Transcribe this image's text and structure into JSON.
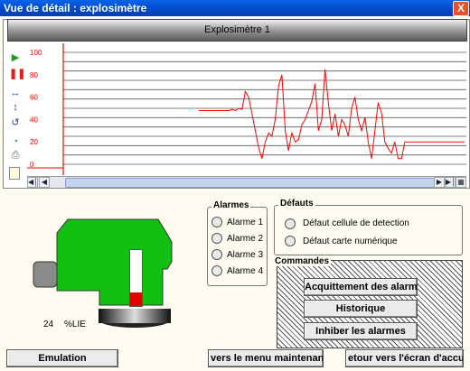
{
  "window": {
    "title": "Vue de détail : explosimètre",
    "close_label": "X"
  },
  "chart": {
    "title": "Explosimètre 1"
  },
  "chart_data": {
    "type": "line",
    "title": "Explosimètre 1",
    "ylim": [
      0,
      100
    ],
    "yticks": [
      0,
      20,
      40,
      60,
      80,
      100
    ],
    "color": "#FF0000",
    "series": [
      {
        "values": [
          48,
          48,
          48,
          48,
          48,
          48,
          48,
          48,
          48,
          48,
          49,
          48,
          50,
          49,
          65,
          60,
          45,
          30,
          15,
          5,
          20,
          28,
          25,
          40,
          70,
          80,
          30,
          12,
          28,
          20,
          22,
          35,
          40,
          48,
          56,
          72,
          30,
          40,
          85,
          55,
          30,
          45,
          25,
          40,
          35,
          25,
          50,
          60,
          40,
          30,
          42,
          20,
          5,
          30,
          55,
          46,
          20,
          14,
          10,
          20,
          5,
          5,
          20,
          20,
          20,
          20,
          20,
          20,
          20,
          20,
          20,
          20,
          20,
          20,
          20,
          20,
          20,
          20,
          20,
          20,
          20
        ]
      }
    ]
  },
  "toolbar_icons": [
    "play-icon",
    "pause-icon",
    "fit-horizontal-icon",
    "fit-vertical-icon",
    "reset-zoom-icon",
    "refresh-icon",
    "print-icon",
    "notes-icon"
  ],
  "alarmes": {
    "legend": "Alarmes",
    "items": [
      "Alarme 1",
      "Alarme 2",
      "Alarme 3",
      "Alarme 4"
    ]
  },
  "defauts": {
    "legend": "Défauts",
    "items": [
      "Défaut cellule de detection",
      "Défaut carte numérique"
    ]
  },
  "commandes": {
    "legend": "Commandes",
    "acquit": "Acquittement des alarmes",
    "historique": "Historique",
    "inhiber": "Inhiber les alarmes"
  },
  "sensor": {
    "value": "24",
    "unit": "%LIE",
    "level": 0.24,
    "body_color": "#12C012",
    "level_color": "#E00000"
  },
  "bottom": {
    "emulation": "Emulation",
    "maintenance": "vers le menu maintenance",
    "accueil": "etour vers l'écran d'accueil"
  }
}
